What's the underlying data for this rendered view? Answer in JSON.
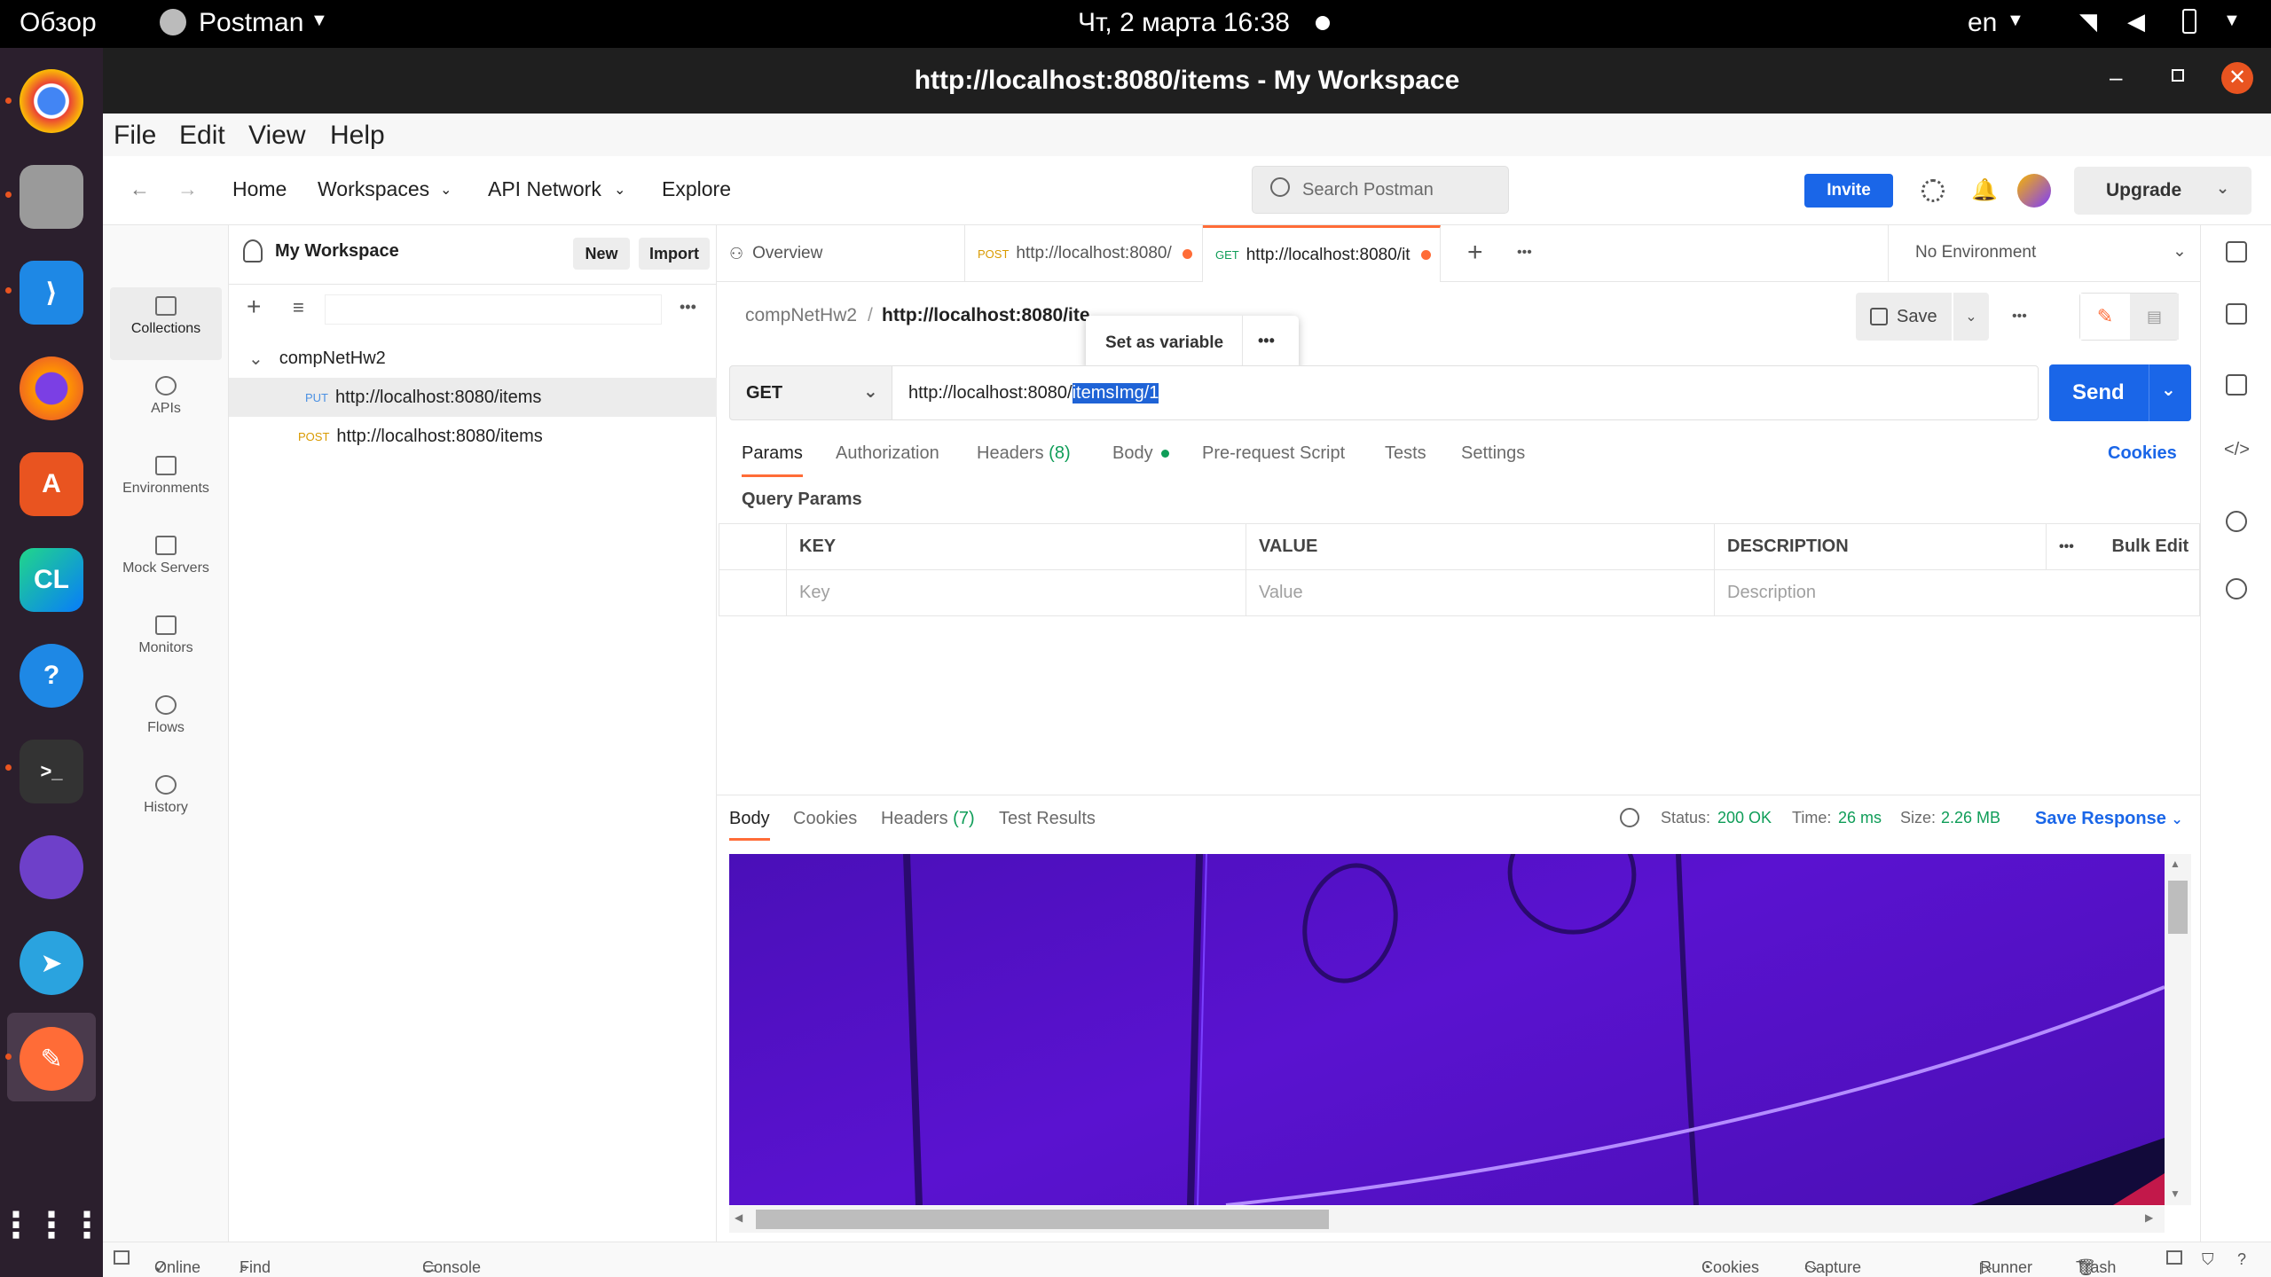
{
  "os": {
    "overview": "Обзор",
    "app_name": "Postman",
    "clock": "Чт, 2 марта  16:38",
    "lang": "en"
  },
  "window": {
    "title": "http://localhost:8080/items - My Workspace"
  },
  "menu": [
    "File",
    "Edit",
    "View",
    "Help"
  ],
  "header": {
    "home": "Home",
    "workspaces": "Workspaces",
    "api_network": "API Network",
    "explore": "Explore",
    "search_placeholder": "Search Postman",
    "invite": "Invite",
    "upgrade": "Upgrade"
  },
  "rail": [
    "Collections",
    "APIs",
    "Environments",
    "Mock Servers",
    "Monitors",
    "Flows",
    "History"
  ],
  "sidebar": {
    "workspace": "My Workspace",
    "new": "New",
    "import": "Import",
    "collection": "compNetHw2",
    "items": [
      {
        "method": "PUT",
        "url": "http://localhost:8080/items",
        "color": "#4a90e2"
      },
      {
        "method": "POST",
        "url": "http://localhost:8080/items",
        "color": "#d99a00"
      }
    ]
  },
  "tabs": {
    "overview": "Overview",
    "tab1_method": "POST",
    "tab1_url": "http://localhost:8080/",
    "tab2_method": "GET",
    "tab2_url": "http://localhost:8080/it",
    "environment": "No Environment"
  },
  "request": {
    "breadcrumb_collection": "compNetHw2",
    "breadcrumb_sep": "/",
    "breadcrumb_name": "http://localhost:8080/ite",
    "popup": "Set as variable",
    "save": "Save",
    "method": "GET",
    "url_prefix": "http://localhost:8080/",
    "url_selected": "itemsImg/1",
    "send": "Send",
    "tabs": [
      "Params",
      "Authorization",
      "Headers",
      "Body",
      "Pre-request Script",
      "Tests",
      "Settings"
    ],
    "headers_count": "(8)",
    "cookies": "Cookies",
    "query_params": "Query Params",
    "columns": [
      "KEY",
      "VALUE",
      "DESCRIPTION"
    ],
    "bulk_edit": "Bulk Edit",
    "placeholders": [
      "Key",
      "Value",
      "Description"
    ]
  },
  "response": {
    "tabs": [
      "Body",
      "Cookies",
      "Headers",
      "Test Results"
    ],
    "headers_count": "(7)",
    "status_label": "Status:",
    "status_value": "200 OK",
    "time_label": "Time:",
    "time_value": "26 ms",
    "size_label": "Size:",
    "size_value": "2.26 MB",
    "save_response": "Save Response"
  },
  "statusbar": {
    "online": "Online",
    "find_replace": "Find and Replace",
    "console": "Console",
    "cookies": "Cookies",
    "capture": "Capture requests",
    "runner": "Runner",
    "trash": "Trash"
  },
  "colors": {
    "accent": "#ff6c37",
    "primary": "#1a66e8",
    "success": "#0f9d58"
  }
}
